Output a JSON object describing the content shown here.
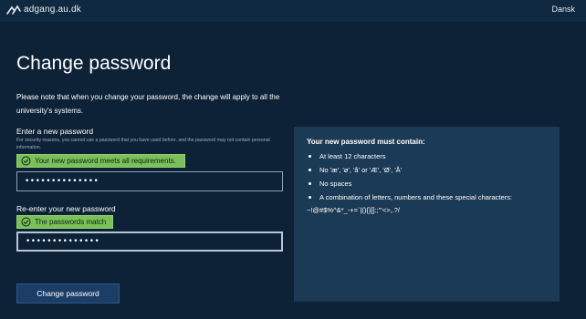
{
  "header": {
    "site_name": "adgang.au.dk",
    "language_link": "Dansk"
  },
  "page": {
    "title": "Change password",
    "note": "Please note that when you change your password, the change will apply to all the university's systems."
  },
  "new_password": {
    "label": "Enter a new password",
    "hint": "For security reasons, you cannot use a password that you have used before, and the password may not contain personal information.",
    "status": "Your new password meets all requirements.",
    "value": "••••••••••••••"
  },
  "confirm_password": {
    "label": "Re-enter your new password",
    "status": "The passwords match",
    "value": "••••••••••••••"
  },
  "submit_label": "Change password",
  "requirements": {
    "title": "Your new password must contain:",
    "items": [
      "At least 12 characters",
      "No 'æ', 'ø', 'å' or 'Æ', 'Ø', 'Å'",
      "No spaces",
      "A combination of letters, numbers and these special characters:"
    ],
    "special_chars": "~!@#$%^&*_-+=`|(){}[]:;\"'<>,.?/"
  },
  "colors": {
    "background": "#0d2236",
    "panel": "#1b3a55",
    "success": "#7bc05a",
    "button": "#1b3d66"
  }
}
